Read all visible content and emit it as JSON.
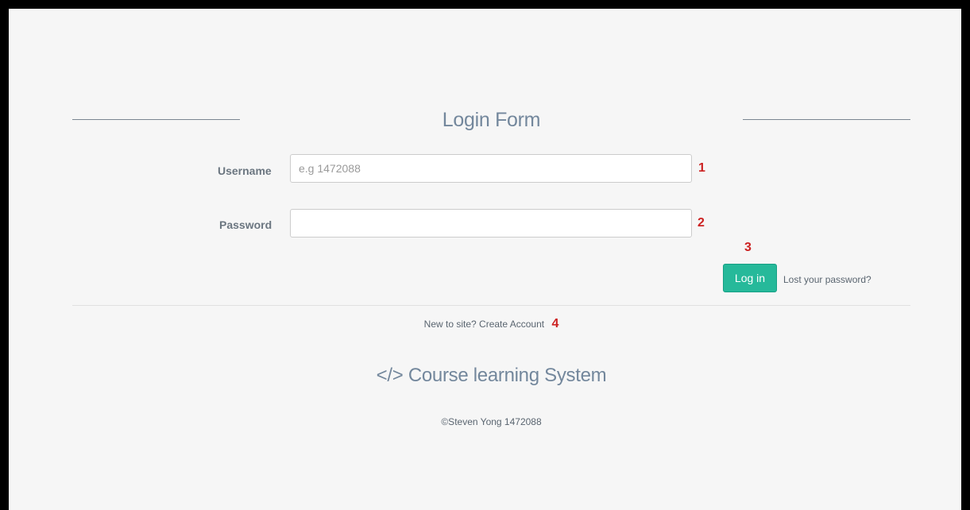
{
  "form": {
    "title": "Login Form",
    "username_label": "Username",
    "username_placeholder": "e.g 1472088",
    "username_value": "",
    "password_label": "Password",
    "password_placeholder": "",
    "password_value": "",
    "login_label": "Log in",
    "lost_password_label": "Lost your password?"
  },
  "signup": {
    "prompt": "New to site?",
    "create_account_label": "Create Account"
  },
  "footer": {
    "brand": "</> Course learning System",
    "copyright": "©Steven Yong 1472088"
  },
  "annotations": {
    "marker_1": "1",
    "marker_2": "2",
    "marker_3": "3",
    "marker_4": "4"
  },
  "colors": {
    "accent": "#26b99a",
    "marker": "#cc2222",
    "heading": "#73879c",
    "background": "#f6f6f6"
  }
}
